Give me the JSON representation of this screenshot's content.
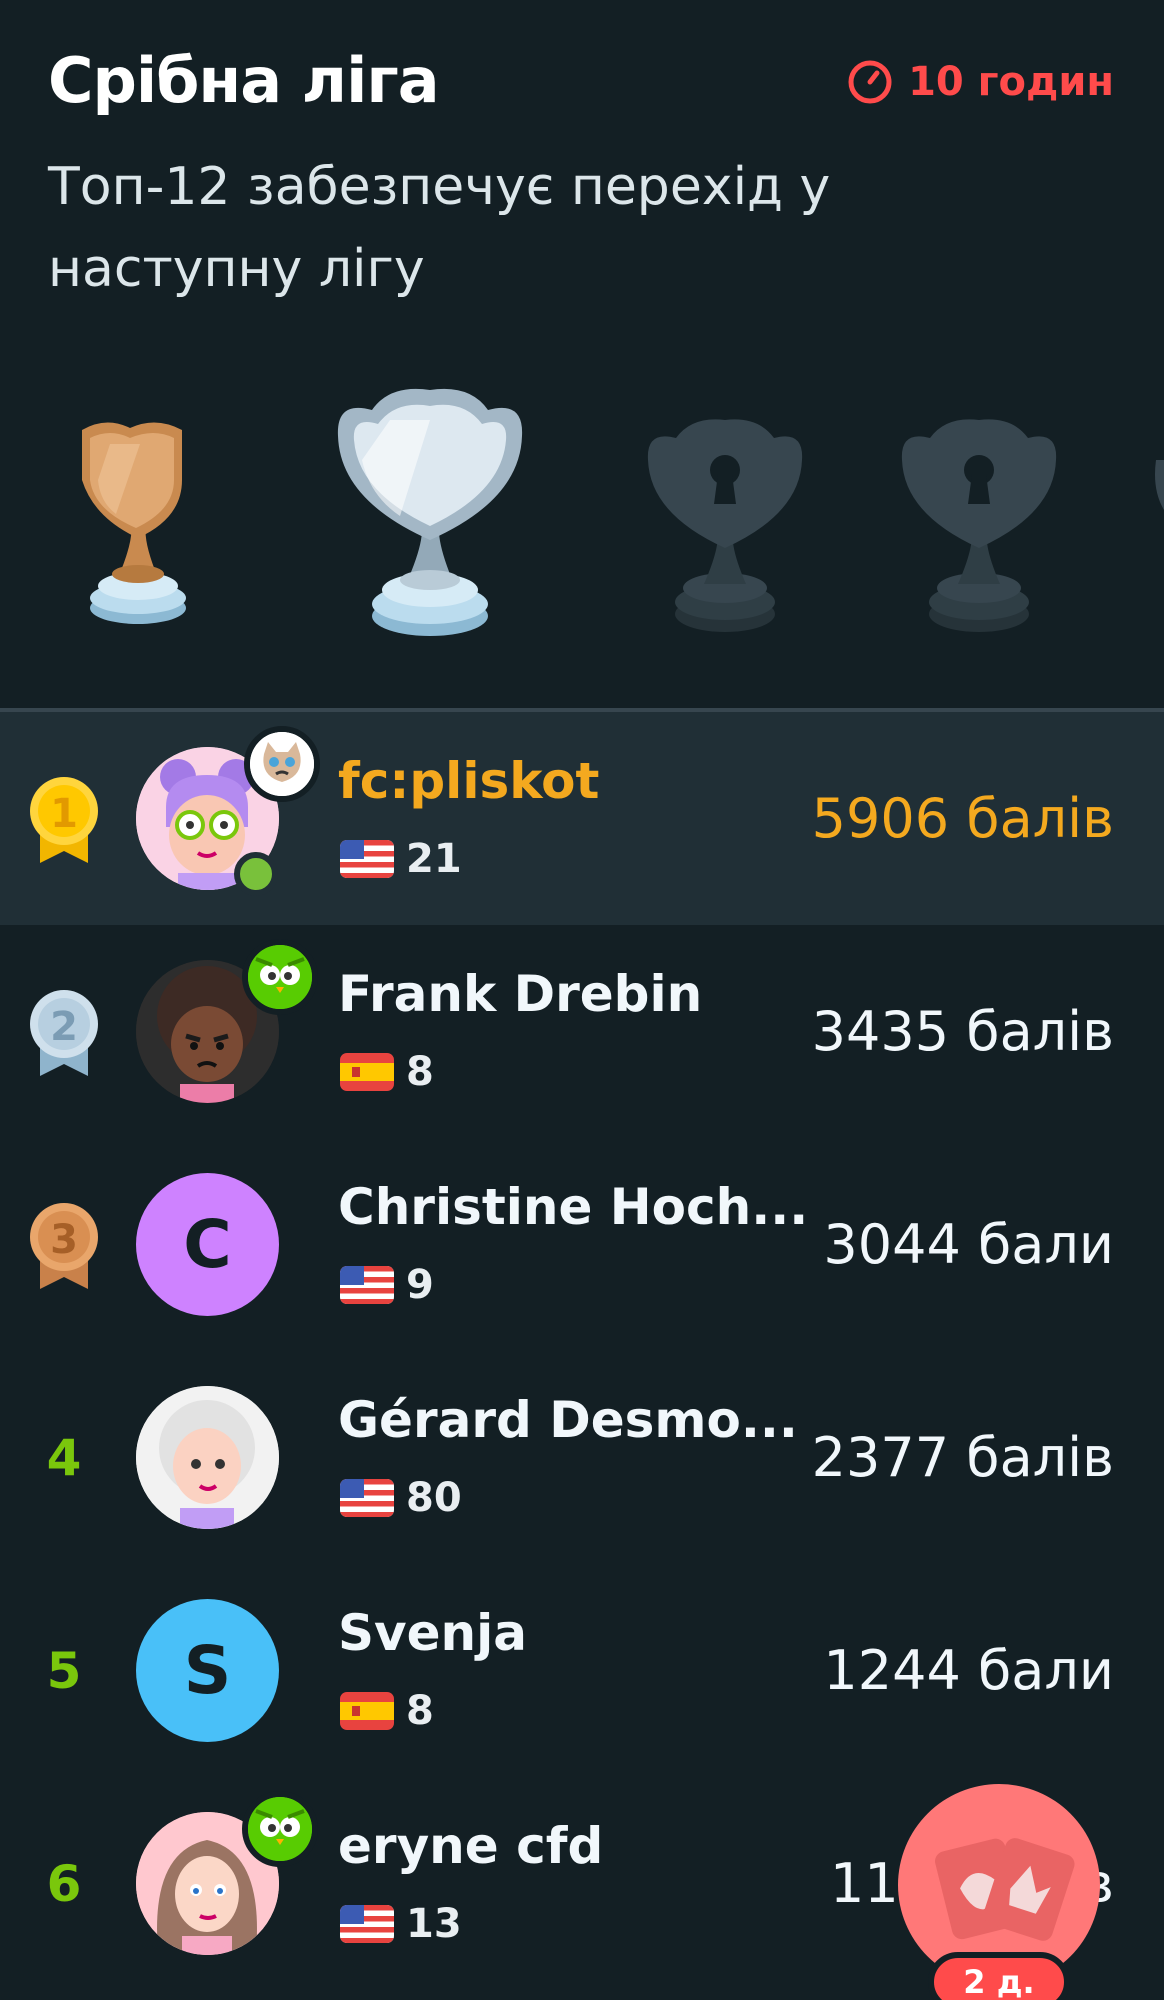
{
  "header": {
    "title": "Срібна ліга",
    "timer_text": "10 годин",
    "subtitle": "Топ-12 забезпечує перехід у наступну лігу"
  },
  "colors": {
    "background": "#131f24",
    "highlight_row": "#202f36",
    "accent_gold": "#f4a91f",
    "timer_red": "#ff4b4b",
    "rank_green": "#7ac70c"
  },
  "leagues": [
    {
      "name": "bronze",
      "state": "completed"
    },
    {
      "name": "silver",
      "state": "current"
    },
    {
      "name": "locked-3",
      "state": "locked"
    },
    {
      "name": "locked-4",
      "state": "locked"
    }
  ],
  "leaderboard": [
    {
      "rank": "1",
      "rank_style": "gold-medal",
      "name": "fc:pliskot",
      "flag": "us",
      "streak": "21",
      "points": "5906 балів",
      "is_me": true,
      "avatar": "girl-purple-hair",
      "badge": "cat",
      "online": true
    },
    {
      "rank": "2",
      "rank_style": "silver-medal",
      "name": "Frank Drebin",
      "flag": "es",
      "streak": "8",
      "points": "3435 балів",
      "is_me": false,
      "avatar": "curly-dark",
      "badge": "owl"
    },
    {
      "rank": "3",
      "rank_style": "bronze-medal",
      "name": "Christine Hoch...",
      "flag": "us",
      "streak": "9",
      "points": "3044 бали",
      "is_me": false,
      "avatar_letter": "C",
      "avatar_color": "#ce82ff"
    },
    {
      "rank": "4",
      "rank_style": "number",
      "name": "Gérard Desmo...",
      "flag": "us",
      "streak": "80",
      "points": "2377 балів",
      "is_me": false,
      "avatar": "old-lady"
    },
    {
      "rank": "5",
      "rank_style": "number",
      "name": "Svenja",
      "flag": "es",
      "streak": "8",
      "points": "1244 бали",
      "is_me": false,
      "avatar_letter": "S",
      "avatar_color": "#49c0f8"
    },
    {
      "rank": "6",
      "rank_style": "number",
      "name": "eryne cfd",
      "flag": "us",
      "streak": "13",
      "points": "11",
      "points_suffix": "в",
      "is_me": false,
      "avatar": "blonde-girl",
      "badge": "owl"
    }
  ],
  "fab": {
    "badge_text": "2 д.",
    "icon": "cards-icon"
  }
}
